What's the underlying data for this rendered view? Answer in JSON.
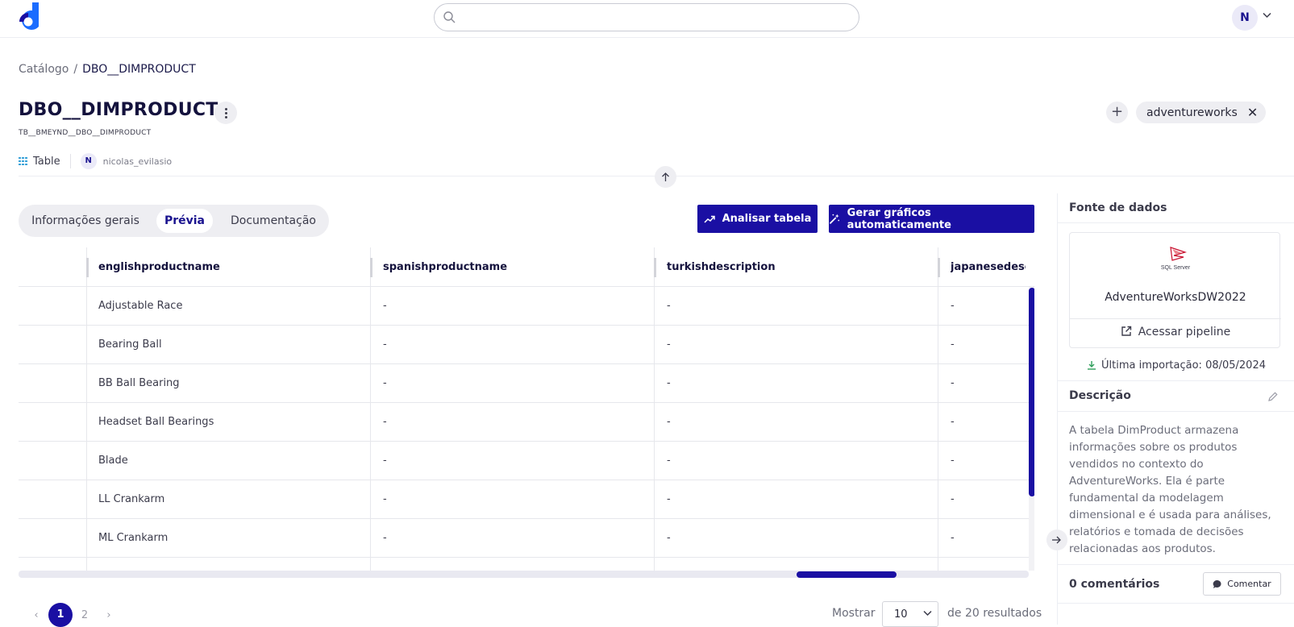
{
  "header": {
    "search_placeholder": "",
    "user_initial": "N"
  },
  "breadcrumb": {
    "root": "Catálogo",
    "separator": "/",
    "current": "DBO__DIMPRODUCT"
  },
  "page": {
    "title": "DBO__DIMPRODUCT",
    "subtitle": "TB__BMEYND__DBO__DIMPRODUCT",
    "type_label": "Table",
    "owner_initial": "N",
    "owner": "nicolas_evilasio",
    "tag_add": "+",
    "tag": "adventureworks",
    "tag_remove": "✕"
  },
  "tabs": [
    {
      "label": "Informações gerais",
      "active": false
    },
    {
      "label": "Prévia",
      "active": true
    },
    {
      "label": "Documentação",
      "active": false
    }
  ],
  "actions": {
    "analyze_label": "Analisar tabela",
    "charts_label": "Gerar gráficos automaticamente"
  },
  "table": {
    "columns": [
      "englishproductname",
      "spanishproductname",
      "turkishdescription",
      "japanesedescri"
    ],
    "rows": [
      [
        "Adjustable Race",
        "-",
        "-",
        "-"
      ],
      [
        "Bearing Ball",
        "-",
        "-",
        "-"
      ],
      [
        "BB Ball Bearing",
        "-",
        "-",
        "-"
      ],
      [
        "Headset Ball Bearings",
        "-",
        "-",
        "-"
      ],
      [
        "Blade",
        "-",
        "-",
        "-"
      ],
      [
        "LL Crankarm",
        "-",
        "-",
        "-"
      ],
      [
        "ML Crankarm",
        "-",
        "-",
        "-"
      ]
    ]
  },
  "pagination": {
    "prev": "‹",
    "pages": [
      "1",
      "2"
    ],
    "current": "1",
    "next": "›",
    "show_label": "Mostrar",
    "page_size": "10",
    "results_label": "de 20 resultados"
  },
  "panel": {
    "source_heading": "Fonte de dados",
    "source_logo_text": "SQL Server",
    "source_name": "AdventureWorksDW2022",
    "pipeline_link": "Acessar pipeline",
    "last_import": "Última importação: 08/05/2024",
    "description_heading": "Descrição",
    "description": "A tabela DimProduct armazena informações sobre os produtos vendidos no contexto do AdventureWorks. Ela é parte fundamental da modelagem dimensional e é usada para análises, relatórios e tomada de decisões relacionadas aos produtos.",
    "comments_count": "0 comentários",
    "comment_button": "Comentar"
  },
  "colors": {
    "primary": "#1a0fa3",
    "text_dark": "#14123d",
    "chip_bg": "#eeeef2"
  }
}
